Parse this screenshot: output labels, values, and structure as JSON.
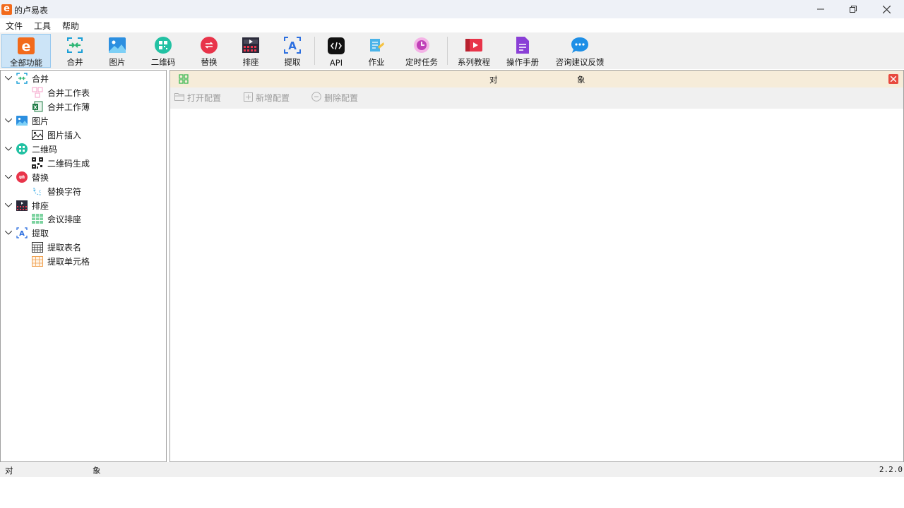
{
  "window": {
    "title": "的卢易表"
  },
  "menu": {
    "file": "文件",
    "tools": "工具",
    "help": "帮助"
  },
  "toolbar": {
    "all": "全部功能",
    "merge": "合并",
    "picture": "图片",
    "qrcode": "二维码",
    "replace": "替换",
    "seating": "排座",
    "extract": "提取",
    "api": "API",
    "job": "作业",
    "schedule": "定时任务",
    "tutorials": "系列教程",
    "manual": "操作手册",
    "feedback": "咨询建议反馈"
  },
  "tree": {
    "merge": {
      "label": "合并",
      "children": [
        "合并工作表",
        "合并工作薄"
      ]
    },
    "picture": {
      "label": "图片",
      "children": [
        "图片插入"
      ]
    },
    "qrcode": {
      "label": "二维码",
      "children": [
        "二维码生成"
      ]
    },
    "replace": {
      "label": "替换",
      "children": [
        "替换字符"
      ]
    },
    "seating": {
      "label": "排座",
      "children": [
        "会议排座"
      ]
    },
    "extract": {
      "label": "提取",
      "children": [
        "提取表名",
        "提取单元格"
      ]
    }
  },
  "panel": {
    "header_left": "对",
    "header_right": "象",
    "open_config": "打开配置",
    "new_config": "新增配置",
    "delete_config": "删除配置"
  },
  "status": {
    "left": "对",
    "middle": "象",
    "version": "2.2.0"
  },
  "colors": {
    "accent": "#f26a1b",
    "selection": "#cce4f7",
    "panel_header": "#f6ecd9",
    "close": "#e84a3e"
  }
}
